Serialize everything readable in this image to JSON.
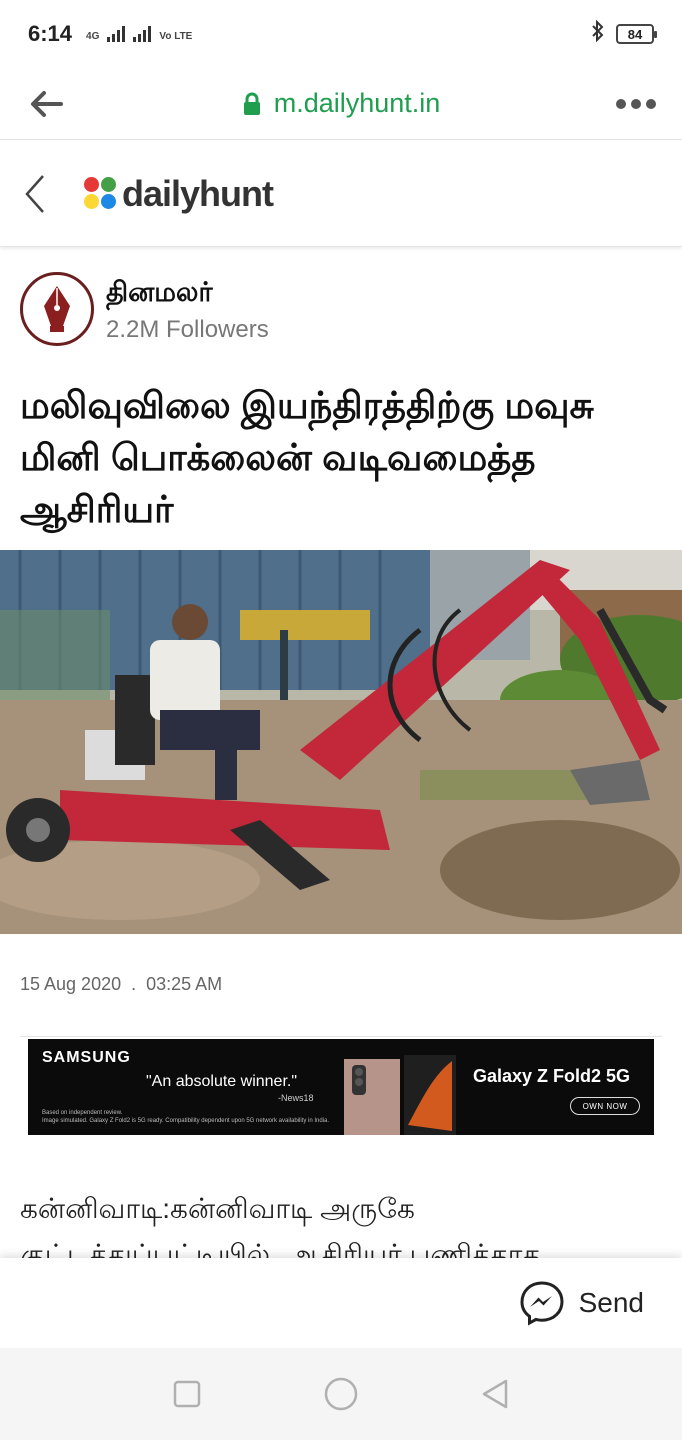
{
  "status_bar": {
    "time": "6:14",
    "signal_1_tag": "4G",
    "signal_2_tag": "Vo LTE",
    "battery": "84"
  },
  "browser": {
    "url": "m.dailyhunt.in"
  },
  "app_header": {
    "logo_text": "dailyhunt",
    "logo_colors": [
      "#e53935",
      "#43a047",
      "#1e88e5",
      "#fdd835"
    ]
  },
  "publisher": {
    "name": "தினமலர்",
    "followers": "2.2M Followers",
    "brand_color": "#6a1e1e"
  },
  "article": {
    "headline": "மலிவுவிலை இயந்திரத்திற்கு மவுசு மினி பொக்லைன் வடிவமைத்த ஆசிரியர்",
    "date": "15 Aug 2020",
    "separator": ".",
    "time": "03:25 AM",
    "body_preview": "கன்னிவாடி:கன்னிவாடி அருகே குட்டத்துப்பட்டியில், ஆசிரியர் பணிக்காக"
  },
  "ad": {
    "brand": "SAMSUNG",
    "quote": "\"An absolute winner.\"",
    "source": "-News18",
    "fine_print_1": "Based on independent review.",
    "fine_print_2": "Image simulated. Galaxy Z Fold2 is 5G ready. Compatibility dependent upon 5G network availability in India.",
    "product": "Galaxy Z Fold2 5G",
    "cta": "OWN NOW"
  },
  "share": {
    "send_label": "Send"
  },
  "icons": {
    "back": "arrow-left-icon",
    "lock": "lock-icon",
    "more": "more-horizontal-icon",
    "messenger": "messenger-icon"
  }
}
